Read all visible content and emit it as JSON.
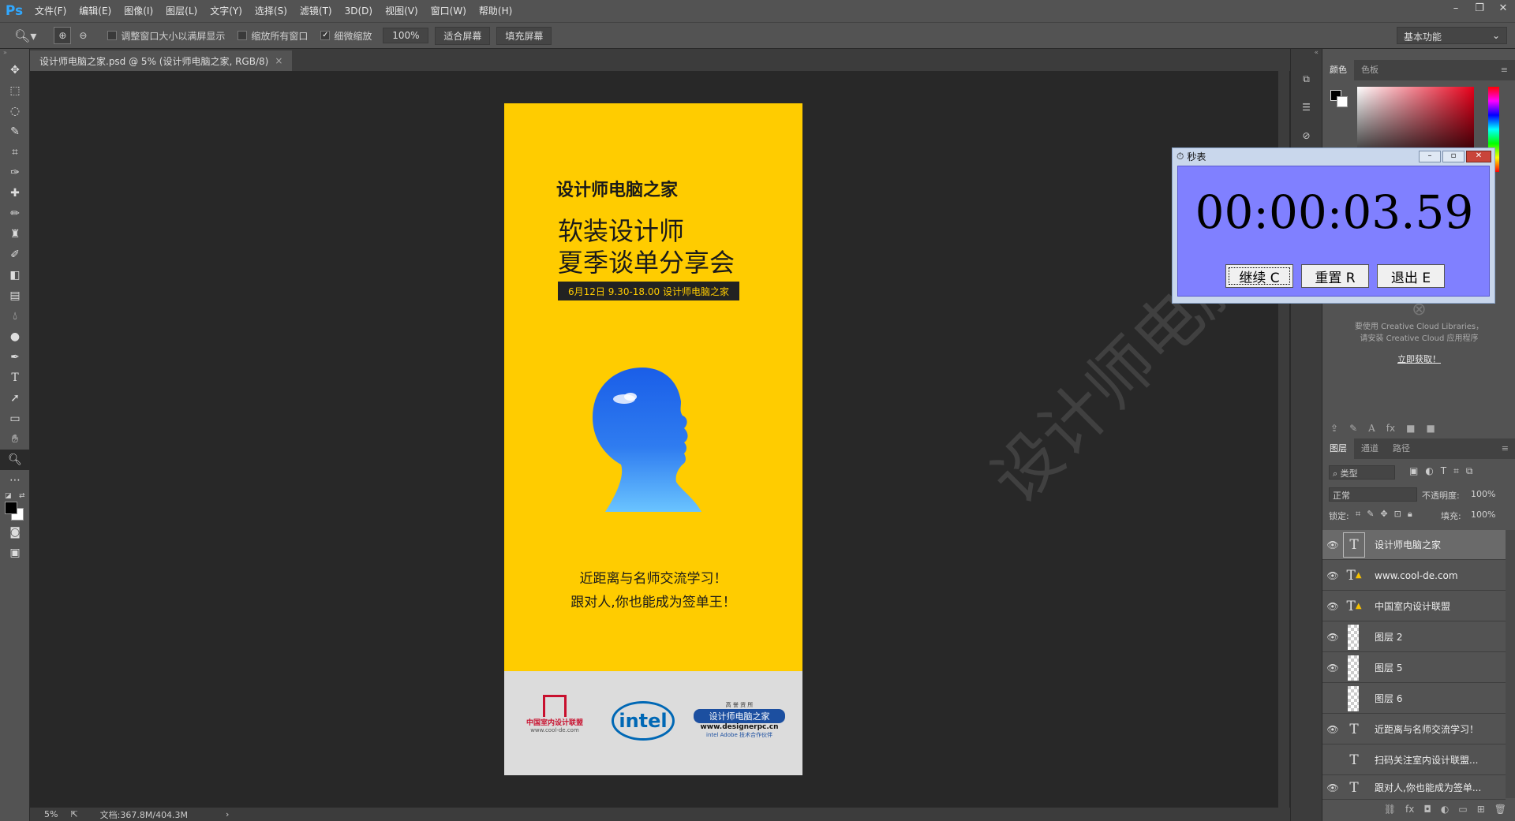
{
  "app": {
    "logo": "Ps"
  },
  "menu": [
    "文件(F)",
    "编辑(E)",
    "图像(I)",
    "图层(L)",
    "文字(Y)",
    "选择(S)",
    "滤镜(T)",
    "3D(D)",
    "视图(V)",
    "窗口(W)",
    "帮助(H)"
  ],
  "options": {
    "resize_windows": "调整窗口大小以满屏显示",
    "zoom_all": "缩放所有窗口",
    "scrubby_zoom": "细微缩放",
    "zoom_value": "100%",
    "fit_screen": "适合屏幕",
    "fill_screen": "填充屏幕",
    "workspace": "基本功能"
  },
  "document": {
    "tab_title": "设计师电脑之家.psd @ 5% (设计师电脑之家, RGB/8)",
    "brand": "设计师电脑之家",
    "headline_1": "软装设计师",
    "headline_2": "夏季谈单分享会",
    "date_line": "6月12日 9.30-18.00 设计师电脑之家",
    "slogan_1": "近距离与名师交流学习！",
    "slogan_2": "跟对人,你也能成为签单王！",
    "footer_logo1_name": "中国室内设计联盟",
    "footer_logo1_url": "www.cool-de.com",
    "footer_intel": "intel",
    "footer_logo3_top": "高 誉 资 所",
    "footer_logo3_name": "设计师电脑之家",
    "footer_logo3_url": "www.designerpc.cn",
    "footer_logo3_partner": "intel Adobe 技术合作伙伴"
  },
  "status": {
    "zoom": "5%",
    "doc_size": "文档:367.8M/404.3M"
  },
  "color_panel": {
    "tab_color": "颜色",
    "tab_swatches": "色板"
  },
  "libraries": {
    "line1": "要使用 Creative Cloud Libraries，",
    "line2": "请安装 Creative Cloud 应用程序",
    "link": "立即获取！"
  },
  "layers_panel": {
    "tab_layers": "图层",
    "tab_channels": "通道",
    "tab_paths": "路径",
    "filter_kind": "类型",
    "blend_mode": "正常",
    "opacity_label": "不透明度:",
    "opacity_value": "100%",
    "lock_label": "锁定:",
    "fill_label": "填充:",
    "fill_value": "100%",
    "layers": [
      {
        "name": "设计师电脑之家",
        "kind": "T",
        "visible": true,
        "selected": true
      },
      {
        "name": "www.cool-de.com",
        "kind": "T!",
        "visible": true
      },
      {
        "name": "中国室内设计联盟",
        "kind": "T!",
        "visible": true
      },
      {
        "name": "图层 2",
        "kind": "px",
        "visible": true
      },
      {
        "name": "图层 5",
        "kind": "px",
        "visible": true
      },
      {
        "name": "图层 6",
        "kind": "px",
        "visible": false
      },
      {
        "name": "近距离与名师交流学习！",
        "kind": "T",
        "visible": true
      },
      {
        "name": "扫码关注室内设计联盟...",
        "kind": "T",
        "visible": false
      },
      {
        "name": "跟对人,你也能成为签单...",
        "kind": "T",
        "visible": true
      }
    ]
  },
  "watermark": "设计师电脑之家",
  "stopwatch": {
    "title": "秒表",
    "time": "00:00:03.59",
    "continue_btn": "继续 C",
    "reset_btn": "重置 R",
    "exit_btn": "退出 E"
  }
}
